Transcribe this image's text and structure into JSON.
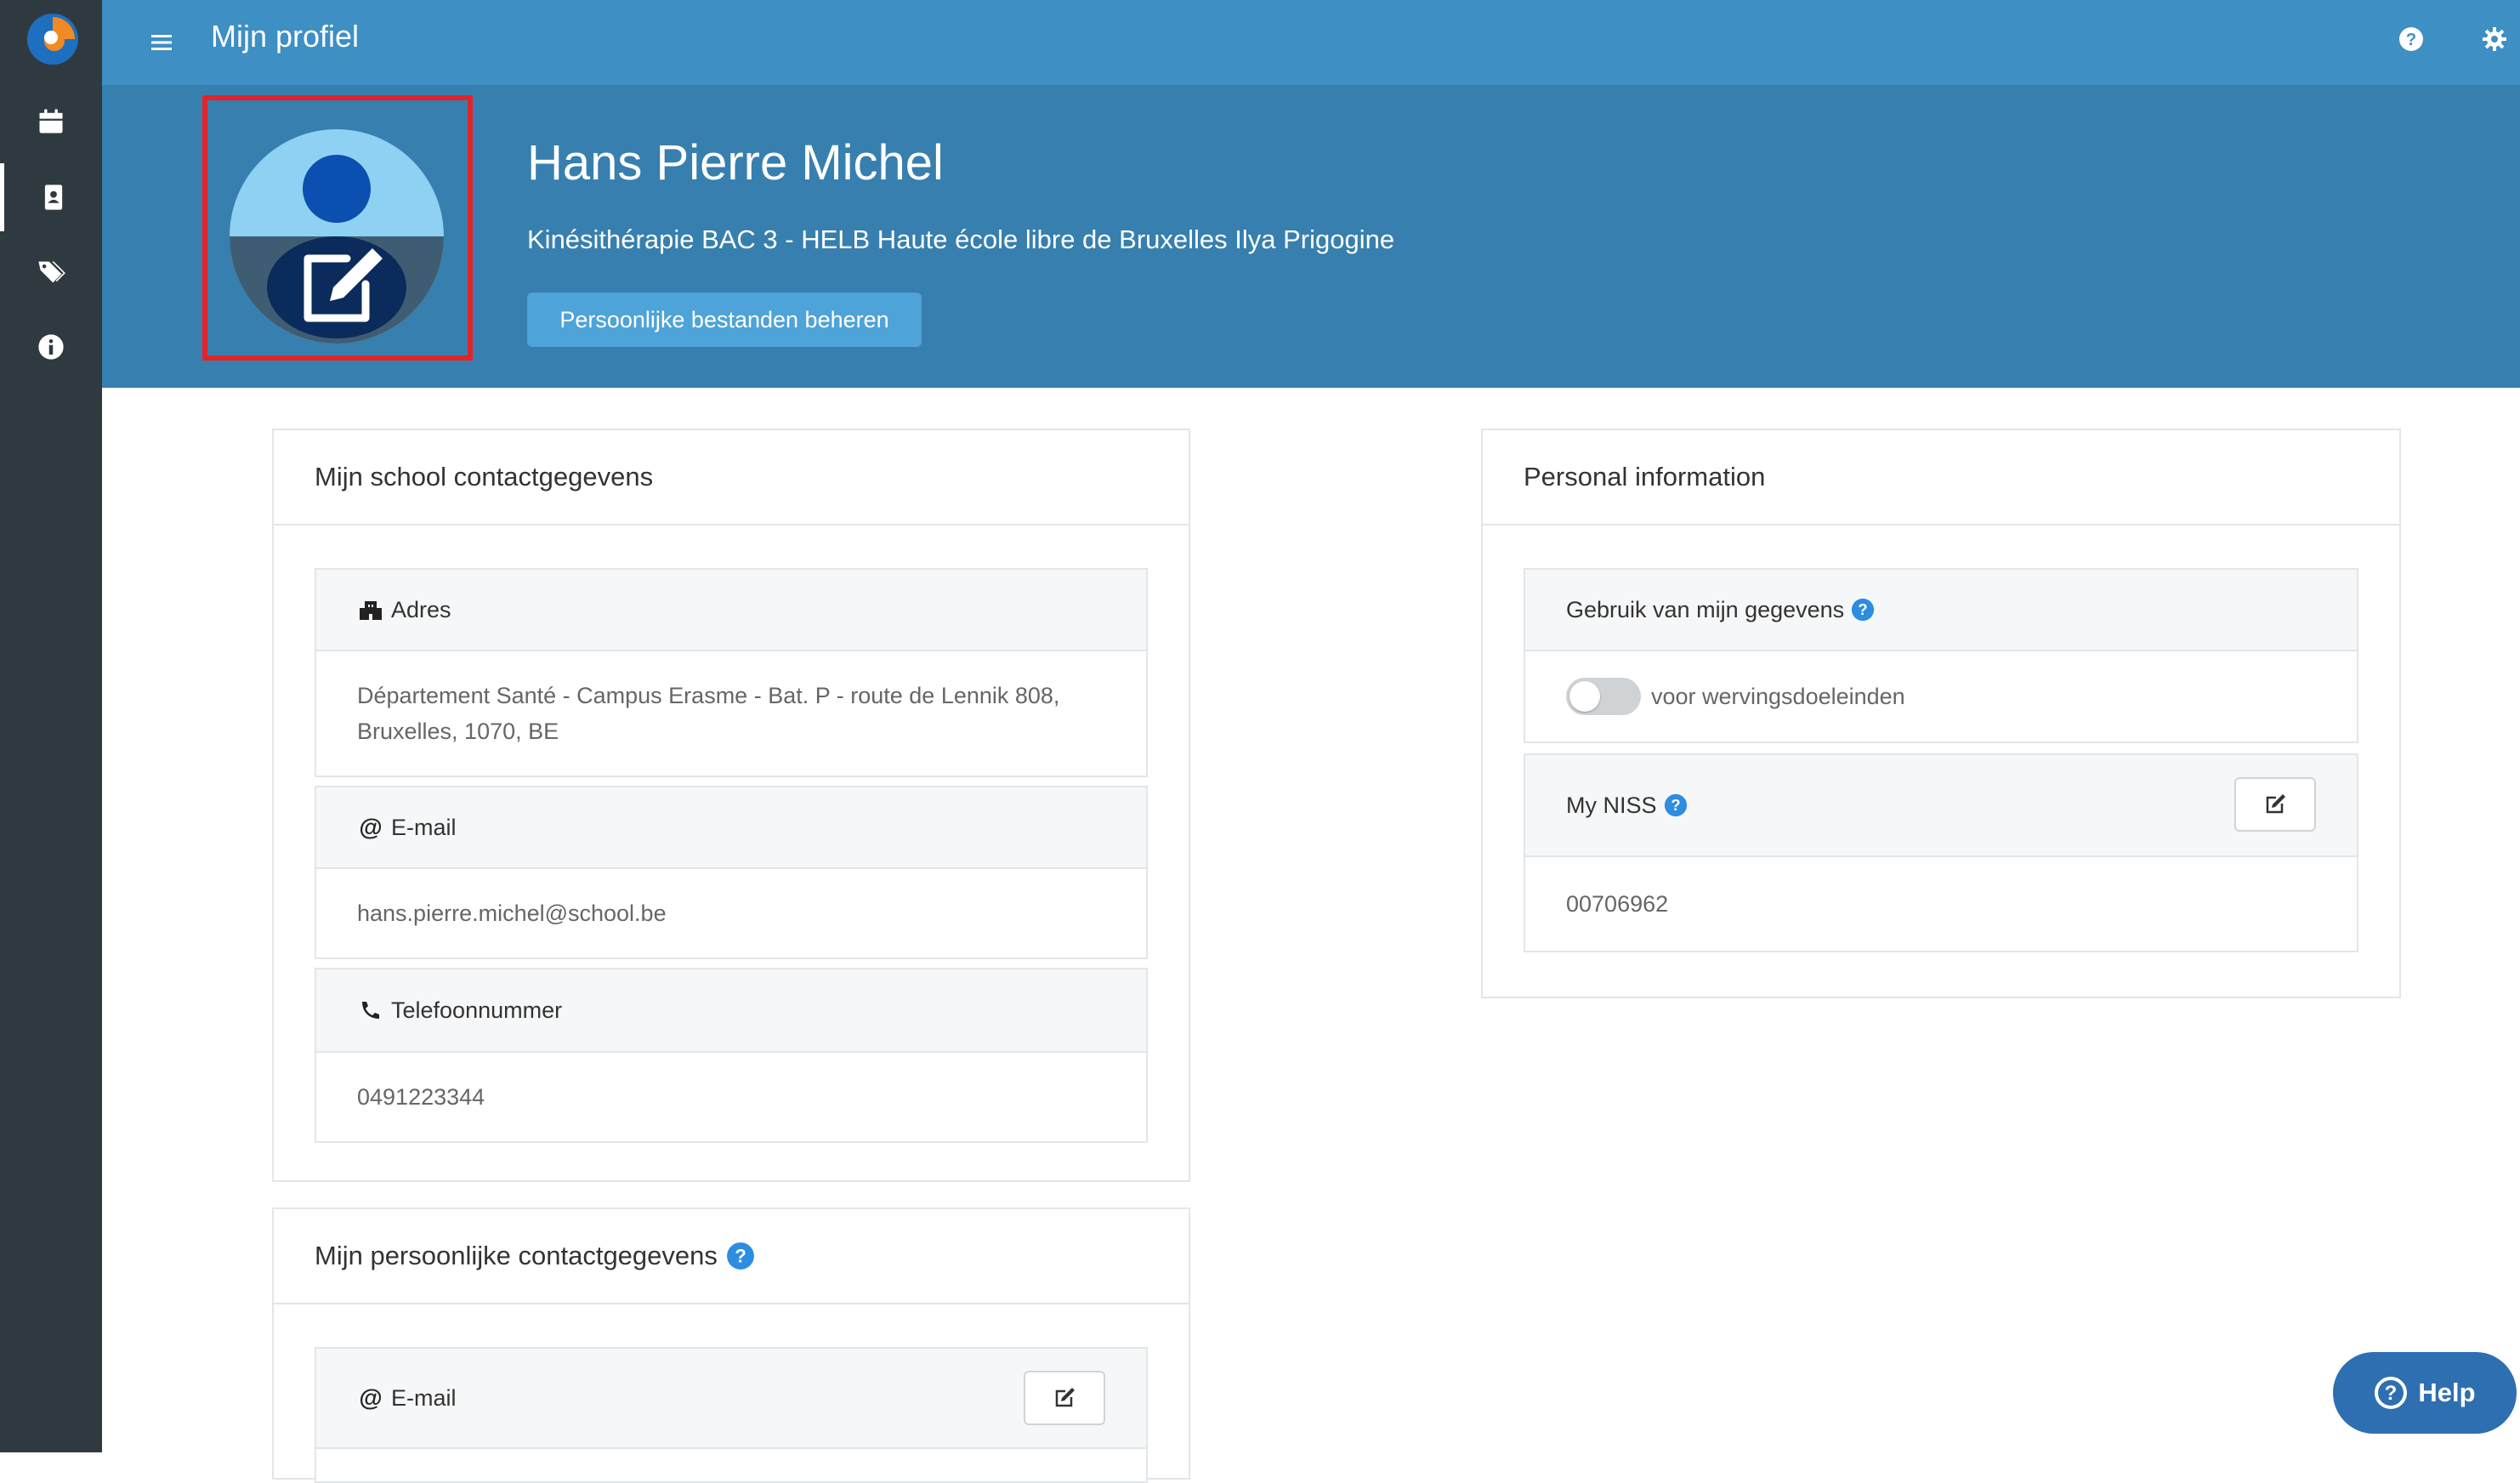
{
  "header": {
    "title": "Mijn profiel"
  },
  "profile": {
    "name": "Hans Pierre Michel",
    "program": "Kinésithérapie BAC 3 - HELB Haute école libre de Bruxelles Ilya Prigogine",
    "files_button": "Persoonlijke bestanden beheren"
  },
  "school_contact": {
    "title": "Mijn school contactgegevens",
    "address_label": "Adres",
    "address_line1": "Département Santé - Campus Erasme - Bat. P - route de Lennik 808,",
    "address_line2": "Bruxelles, 1070, BE",
    "email_label": "E-mail",
    "email_value": "hans.pierre.michel@school.be",
    "phone_label": "Telefoonnummer",
    "phone_value": "0491223344"
  },
  "personal_contact": {
    "title": "Mijn persoonlijke contactgegevens",
    "email_label": "E-mail"
  },
  "personal_info": {
    "title": "Personal information",
    "data_usage_label": "Gebruik van mijn gegevens",
    "recruitment_label": "voor wervingsdoeleinden",
    "recruitment_enabled": false,
    "niss_label": "My NISS",
    "niss_value": "00706962"
  },
  "help_button": {
    "label": "Help"
  },
  "colors": {
    "sidebar": "#2f3a40",
    "topbar": "#3d8fc4",
    "banner": "#377fae",
    "accent_button": "#4ea3d8",
    "help_button": "#2e6fb2",
    "highlight": "#e3232a"
  }
}
